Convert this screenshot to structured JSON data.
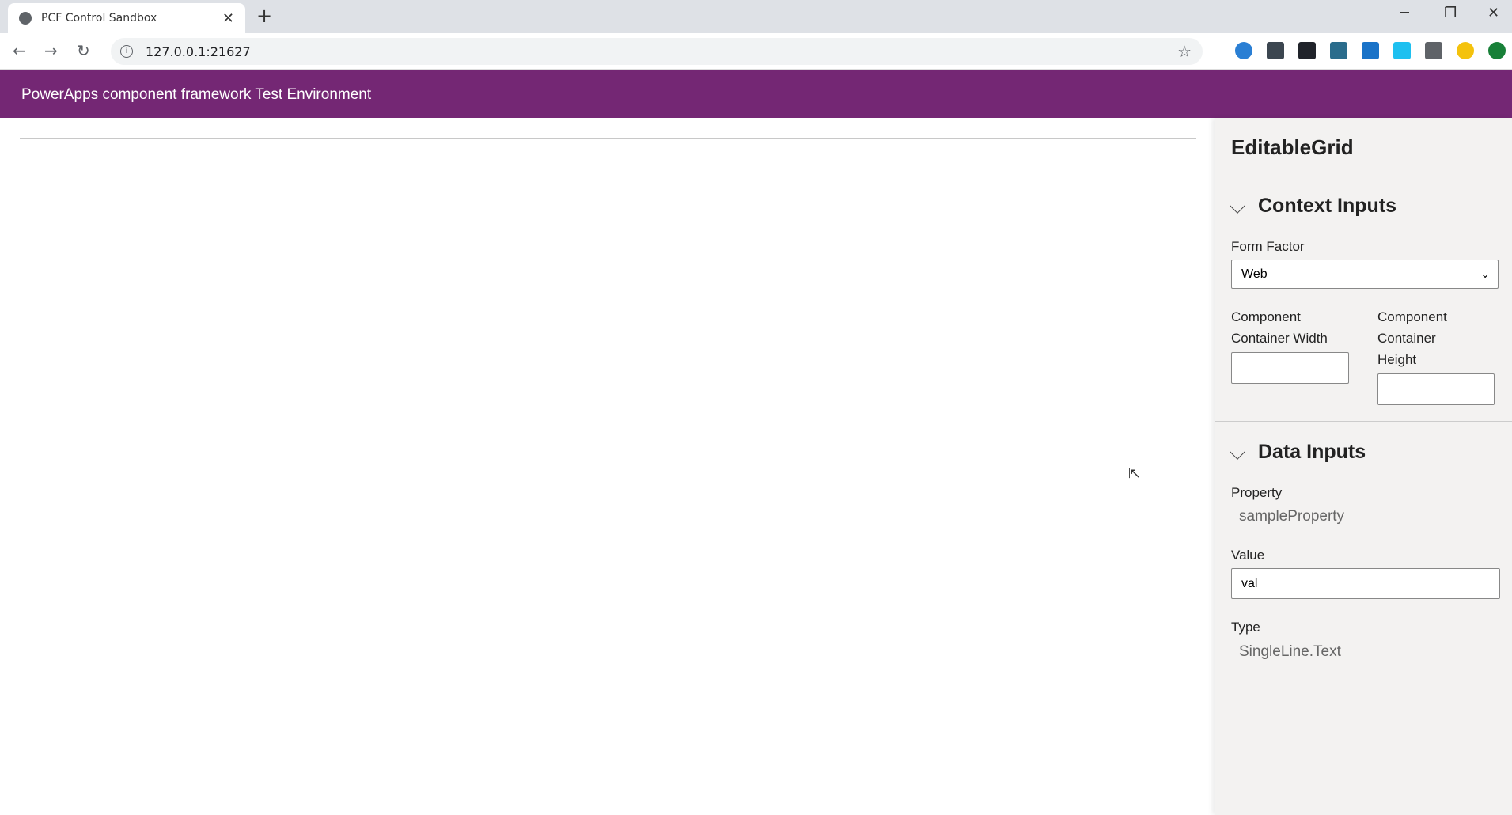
{
  "browser": {
    "tab_title": "PCF Control Sandbox",
    "url": "127.0.0.1:21627",
    "extensions": [
      {
        "icon": "globe-sync-icon",
        "color": "#2a7fd4"
      },
      {
        "icon": "password-manager-icon",
        "color": "#3c4650"
      },
      {
        "icon": "react-devtools-icon",
        "color": "#20232a"
      },
      {
        "icon": "json-viewer-icon",
        "color": "#2a6c8c"
      },
      {
        "icon": "s-extension-icon",
        "color": "#1a73c8"
      },
      {
        "icon": "windows-icon",
        "color": "#1ec0f0"
      },
      {
        "icon": "puzzle-icon",
        "color": "#5f6368"
      },
      {
        "icon": "profile-avatar-icon",
        "color": "#f4c20d"
      },
      {
        "icon": "update-icon",
        "color": "#188038"
      }
    ]
  },
  "header": {
    "title": "PowerApps component framework Test Environment",
    "color": "#742774"
  },
  "panel": {
    "title": "EditableGrid",
    "context": {
      "heading": "Context Inputs",
      "form_factor_label": "Form Factor",
      "form_factor_value": "Web",
      "width_label_1": "Component",
      "width_label_2": "Container Width",
      "height_label_1": "Component",
      "height_label_2": "Container",
      "height_label_3": "Height",
      "width_value": "",
      "height_value": ""
    },
    "data": {
      "heading": "Data Inputs",
      "property_label": "Property",
      "property_value": "sampleProperty",
      "value_label": "Value",
      "value_value": "val",
      "type_label": "Type",
      "type_value": "SingleLine.Text"
    }
  }
}
